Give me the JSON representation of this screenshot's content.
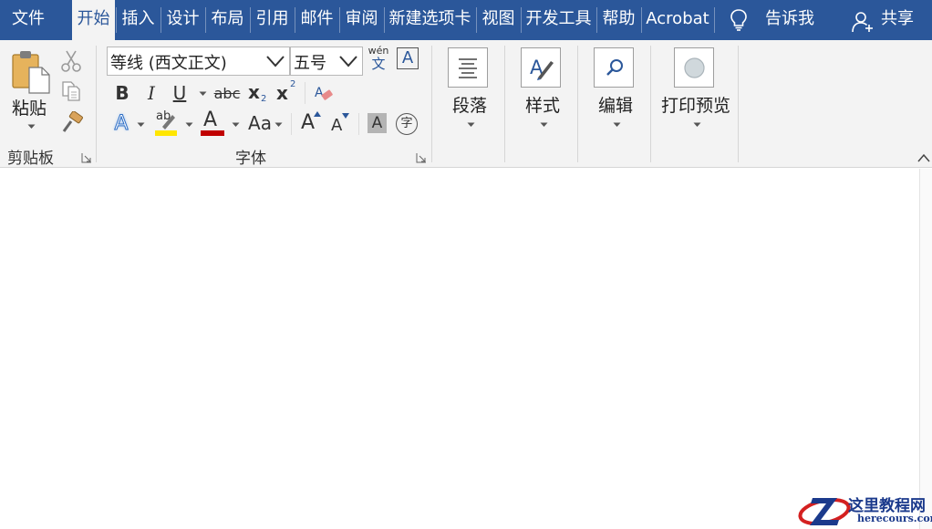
{
  "tabs": [
    {
      "label": "文件"
    },
    {
      "label": "开始"
    },
    {
      "label": "插入"
    },
    {
      "label": "设计"
    },
    {
      "label": "布局"
    },
    {
      "label": "引用"
    },
    {
      "label": "邮件"
    },
    {
      "label": "审阅"
    },
    {
      "label": "新建选项卡"
    },
    {
      "label": "视图"
    },
    {
      "label": "开发工具"
    },
    {
      "label": "帮助"
    },
    {
      "label": "Acrobat"
    }
  ],
  "active_tab": "开始",
  "tell_me": {
    "label": "告诉我",
    "icon": "lightbulb-icon"
  },
  "share": {
    "label": "共享",
    "icon": "person-add-icon"
  },
  "clipboard": {
    "group_label": "剪贴板",
    "paste_label": "粘贴",
    "icons": [
      "paste-icon",
      "cut-icon",
      "copy-icon",
      "format-painter-icon"
    ]
  },
  "font": {
    "group_label": "字体",
    "font_name": "等线 (西文正文)",
    "font_size": "五号",
    "phonetic_top": "wén",
    "phonetic_bottom": "文",
    "border_char": "A",
    "bold": "B",
    "italic": "I",
    "underline": "U",
    "strikethrough": "abc",
    "subscript": "x",
    "subscript_mark": "2",
    "superscript": "x",
    "superscript_mark": "2",
    "effects": "A",
    "highlight": "ab",
    "font_color": "A",
    "change_case": "Aa",
    "grow": "A",
    "shrink": "A",
    "shading": "A",
    "enclose": "字",
    "highlight_color": "#ffe600",
    "font_color_value": "#c00000"
  },
  "groups": {
    "paragraph": "段落",
    "styles": "样式",
    "editing": "编辑",
    "print_preview": "打印预览"
  },
  "colors": {
    "tab_bar": "#2b579a",
    "ribbon": "#f3f3f3"
  },
  "watermark": {
    "cn": "这里教程网",
    "url": "herecours.com"
  }
}
